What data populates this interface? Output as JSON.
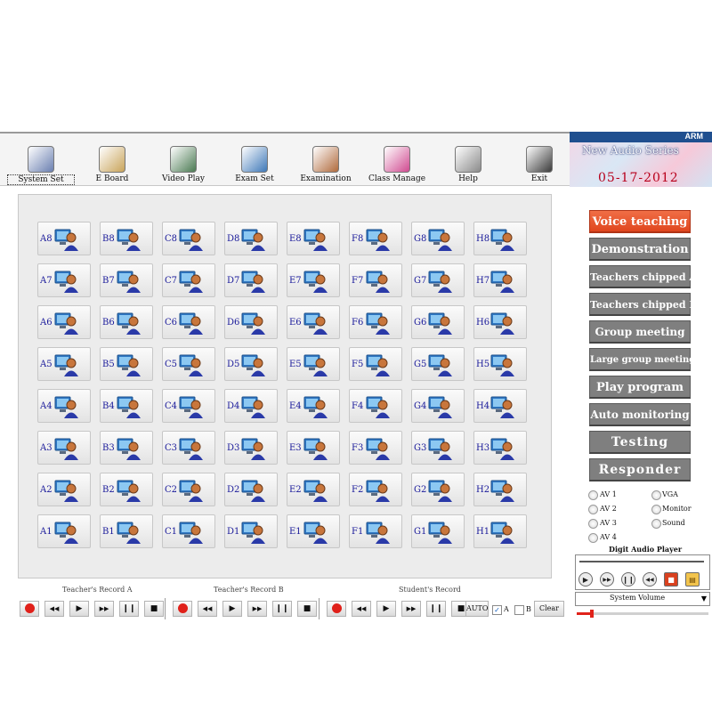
{
  "toolbar": [
    {
      "label": "System Set",
      "icon": "system-set-icon",
      "selected": true
    },
    {
      "label": "E Board",
      "icon": "e-board-icon"
    },
    {
      "label": "Video Play",
      "icon": "video-play-icon"
    },
    {
      "label": "Exam Set",
      "icon": "exam-set-icon"
    },
    {
      "label": "Examination",
      "icon": "examination-icon"
    },
    {
      "label": "Class Manage",
      "icon": "class-manage-icon"
    },
    {
      "label": "Help",
      "icon": "help-icon"
    },
    {
      "label": "Exit",
      "icon": "exit-icon"
    }
  ],
  "brand": {
    "maker": "ARM",
    "series": "New Audio Series",
    "date": "05-17-2012"
  },
  "seats": {
    "columns": [
      "A",
      "B",
      "C",
      "D",
      "E",
      "F",
      "G",
      "H"
    ],
    "rows": [
      8,
      7,
      6,
      5,
      4,
      3,
      2,
      1
    ],
    "icon": "student-computer-icon"
  },
  "modes": [
    {
      "label": "Voice teaching",
      "active": true
    },
    {
      "label": "Demonstration"
    },
    {
      "label": "Teachers chipped A"
    },
    {
      "label": "Teachers chipped B"
    },
    {
      "label": "Group meeting"
    },
    {
      "label": "Large group meeting"
    },
    {
      "label": "Play program"
    },
    {
      "label": "Auto monitoring"
    },
    {
      "label": "Testing"
    },
    {
      "label": "Responder"
    }
  ],
  "av_options": {
    "left": [
      "AV 1",
      "AV 2",
      "AV 3",
      "AV 4"
    ],
    "right": [
      "VGA",
      "Monitor",
      "Sound"
    ]
  },
  "player": {
    "title": "Digit Audio Player",
    "buttons": [
      "play-icon",
      "fast-forward-icon",
      "pause-icon",
      "rewind-icon",
      "stop-icon",
      "open-folder-icon"
    ],
    "volume_label": "System Volume",
    "volume_level": 0.1
  },
  "records": {
    "teacher_a": "Teacher's Record A",
    "teacher_b": "Teacher's Record B",
    "student": "Student's Record",
    "auto_label": "AUTO",
    "check_a_label": "A",
    "check_a_checked": true,
    "check_b_label": "B",
    "check_b_checked": false,
    "clear_label": "Clear"
  },
  "colors": {
    "active_mode": "#e8532a",
    "mode": "#7f7f7f",
    "record": "#e0201a"
  }
}
